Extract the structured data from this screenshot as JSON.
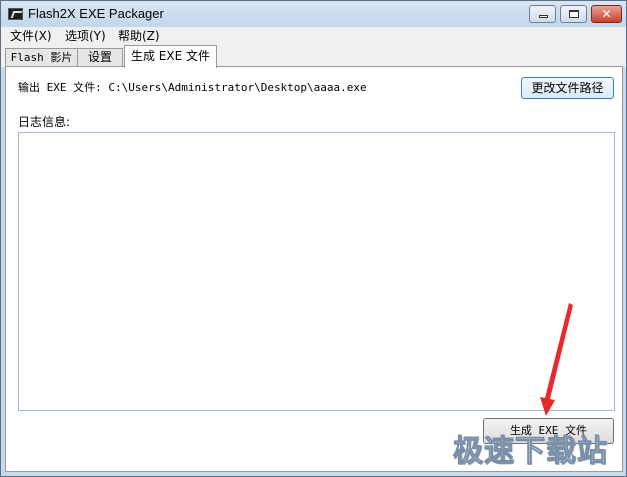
{
  "window": {
    "title": "Flash2X EXE Packager",
    "icon": "flash2x-app-icon",
    "controls": {
      "minimize": "",
      "maximize": "",
      "close": "✕"
    }
  },
  "menu": {
    "items": [
      {
        "label": "文件(X)"
      },
      {
        "label": "选项(Y)"
      },
      {
        "label": "帮助(Z)"
      }
    ]
  },
  "tabs": [
    {
      "label": "Flash 影片",
      "active": false
    },
    {
      "label": "设置",
      "active": false
    },
    {
      "label": "生成 EXE 文件",
      "active": true
    }
  ],
  "panel": {
    "output_label": "输出 EXE 文件:",
    "output_path": "C:\\Users\\Administrator\\Desktop\\aaaa.exe",
    "change_path_button": "更改文件路径",
    "log_label": "日志信息:",
    "log_content": "",
    "build_button": "生成 EXE 文件"
  },
  "watermark": "极速下载站",
  "colors": {
    "arrow": "#e8282b",
    "titlebar": "#c8d9ec",
    "close_button": "#c7432c"
  }
}
